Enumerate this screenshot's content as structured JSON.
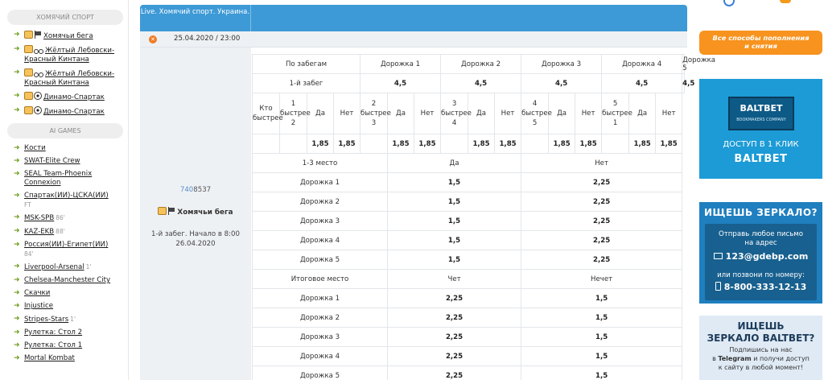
{
  "sidebar": {
    "section1_title": "ХОМЯЧИЙ СПОРТ",
    "hamster_items": [
      {
        "label": "Хомячьи бега"
      },
      {
        "label": "Жёлтый Лебовски-Красный Кинтана"
      },
      {
        "label": "Жёлтый Лебовски-Красный Кинтана"
      },
      {
        "label": "Динамо-Спартак"
      },
      {
        "label": "Динамо-Спартак"
      }
    ],
    "section2_title": "AI GAMES",
    "ai_items": [
      {
        "label": "Кости",
        "sub": ""
      },
      {
        "label": "SWAT-Elite Crew",
        "sub": ""
      },
      {
        "label": "SEAL Team-Phoenix Connexion",
        "sub": ""
      },
      {
        "label": "Спартак(ИИ)-ЦСКА(ИИ)",
        "sub": "FT"
      },
      {
        "label": "MSK-SPB",
        "sub": "86'"
      },
      {
        "label": "KAZ-EKB",
        "sub": "88'"
      },
      {
        "label": "Россия(ИИ)-Египет(ИИ)",
        "sub": "84'"
      },
      {
        "label": "Liverpool-Arsenal",
        "sub": "1'"
      },
      {
        "label": "Chelsea-Manchester City",
        "sub": ""
      },
      {
        "label": "Скачки",
        "sub": ""
      },
      {
        "label": "Injustice",
        "sub": ""
      },
      {
        "label": "Stripes-Stars",
        "sub": "1'"
      },
      {
        "label": "Рулетка: Стол 2",
        "sub": ""
      },
      {
        "label": "Рулетка: Стол 1",
        "sub": ""
      },
      {
        "label": "Mortal Kombat",
        "sub": ""
      }
    ]
  },
  "event": {
    "header_title": "Live. Хомячий спорт. Украина.",
    "date": "25.04.2020 / 23:00",
    "id_highlight": "740",
    "id_rest": "8537",
    "name": "Хомячьи бега",
    "info_line1": "1-й забег. Начало в 8:00",
    "info_line2": "26.04.2020"
  },
  "odds": {
    "header": [
      "По забегам",
      "Дорожка 1",
      "Дорожка 2",
      "Дорожка 3",
      "Дорожка 4",
      "Дорожка 5"
    ],
    "race_row": {
      "label": "1-й забег",
      "values": [
        "4,5",
        "4,5",
        "4,5",
        "4,5",
        "4,5"
      ]
    },
    "faster_headers": [
      "Кто быстрее",
      "1 быстрее 2",
      "Да",
      "Нет",
      "2 быстрее 3",
      "Да",
      "Нет",
      "3 быстрее 4",
      "Да",
      "Нет",
      "4 быстрее 5",
      "Да",
      "Нет",
      "5 быстрее 1",
      "Да",
      "Нет"
    ],
    "faster_values": [
      "",
      "",
      "1,85",
      "1,85",
      "",
      "1,85",
      "1,85",
      "",
      "1,85",
      "1,85",
      "",
      "1,85",
      "1,85",
      "",
      "1,85",
      "1,85"
    ],
    "place13": {
      "header": [
        "1-3 место",
        "Да",
        "Нет"
      ],
      "rows": [
        {
          "label": "Дорожка 1",
          "yes": "1,5",
          "no": "2,25"
        },
        {
          "label": "Дорожка 2",
          "yes": "1,5",
          "no": "2,25"
        },
        {
          "label": "Дорожка 3",
          "yes": "1,5",
          "no": "2,25"
        },
        {
          "label": "Дорожка 4",
          "yes": "1,5",
          "no": "2,25"
        },
        {
          "label": "Дорожка 5",
          "yes": "1,5",
          "no": "2,25"
        }
      ]
    },
    "final_place": {
      "header": [
        "Итоговое место",
        "Чет",
        "Нечет"
      ],
      "rows": [
        {
          "label": "Дорожка 1",
          "even": "2,25",
          "odd": "1,5"
        },
        {
          "label": "Дорожка 2",
          "even": "2,25",
          "odd": "1,5"
        },
        {
          "label": "Дорожка 3",
          "even": "2,25",
          "odd": "1,5"
        },
        {
          "label": "Дорожка 4",
          "even": "2,25",
          "odd": "1,5"
        },
        {
          "label": "Дорожка 5",
          "even": "2,25",
          "odd": "1,5"
        }
      ]
    }
  },
  "banners": {
    "orange_line1": "Все способы пополнения",
    "orange_line2": "и снятия",
    "baltbet_logo": "BALTBET",
    "baltbet_tag": "BOOKMAKERS COMPANY",
    "baltbet_line1": "ДОСТУП В 1 КЛИК",
    "baltbet_line2": "BALTBET",
    "mirror_title": "ИЩЕШЬ ЗЕРКАЛО?",
    "mirror_t1": "Отправь любое письмо",
    "mirror_t2": "на адрес",
    "mirror_email": "123@gdebp.com",
    "mirror_t3": "или позвони по номеру:",
    "mirror_phone": "8-800-333-12-13",
    "tg_line1": "ИЩЕШЬ",
    "tg_line2": "ЗЕРКАЛО BALTBET?",
    "tg_s1": "Подпишись на нас",
    "tg_s2_pre": "в",
    "tg_s2_bold": "Telegram",
    "tg_s2_post": "и получи доступ",
    "tg_s3": "к сайту в любой момент!"
  },
  "colors": {
    "header_blue": "#3d9ad6",
    "sidebar_arrow": "#6a9f1a",
    "orange": "#f7931e",
    "baltbet_blue": "#1c9bd6"
  },
  "icons": [
    "hamster-icon",
    "flag-icon",
    "motorcycle-icon",
    "soccer-ball-icon",
    "close-icon",
    "arrow-right-icon",
    "envelope-icon",
    "phone-icon"
  ]
}
